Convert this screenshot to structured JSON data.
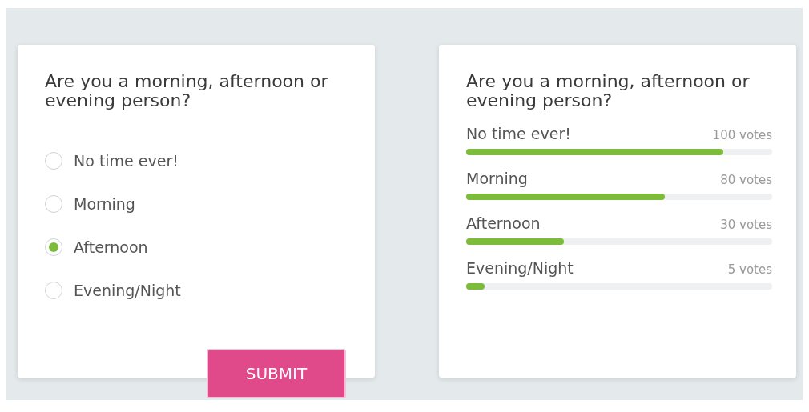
{
  "vote_card": {
    "question": "Are you a morning, afternoon or evening person?",
    "options": [
      {
        "label": "No time ever!",
        "selected": false
      },
      {
        "label": "Morning",
        "selected": false
      },
      {
        "label": "Afternoon",
        "selected": true
      },
      {
        "label": "Evening/Night",
        "selected": false
      }
    ],
    "submit": "SUBMIT"
  },
  "results_card": {
    "question": "Are you a morning, afternoon or evening person?",
    "results": [
      {
        "label": "No time ever!",
        "votes": "100 votes",
        "level": 0.84
      },
      {
        "label": "Morning",
        "votes": "80 votes",
        "level": 0.65
      },
      {
        "label": "Afternoon",
        "votes": "30 votes",
        "level": 0.32
      },
      {
        "label": "Evening/Night",
        "votes": "5 votes",
        "level": 0.06
      }
    ]
  }
}
